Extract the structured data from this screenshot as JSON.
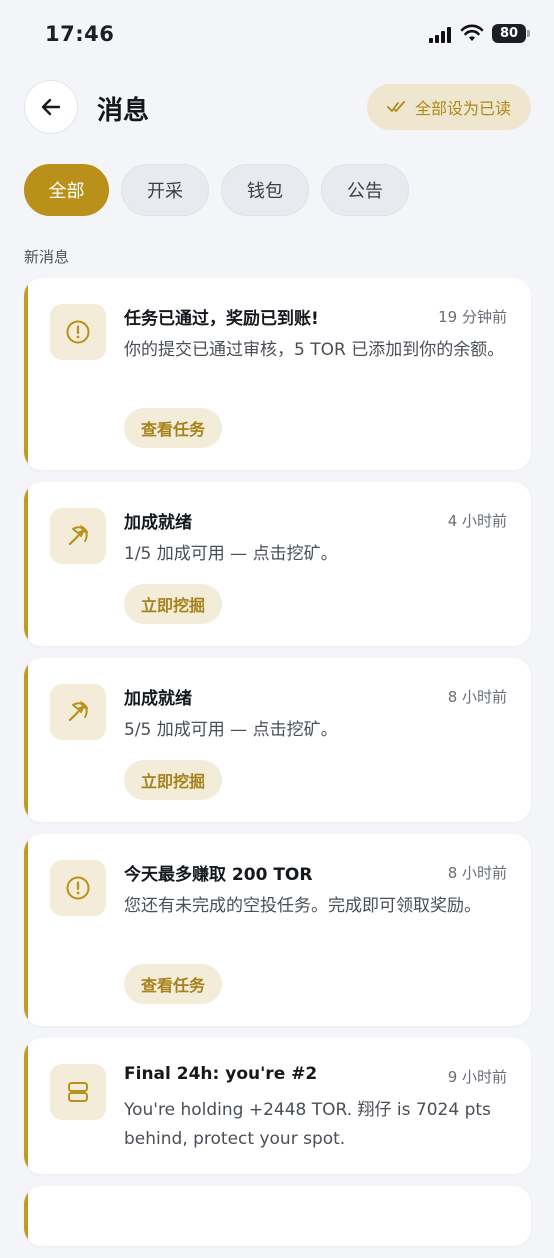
{
  "status_bar": {
    "time": "17:46",
    "battery": "80"
  },
  "header": {
    "title": "消息",
    "mark_all_read": "全部设为已读"
  },
  "tabs": [
    {
      "label": "全部",
      "active": true
    },
    {
      "label": "开采",
      "active": false
    },
    {
      "label": "钱包",
      "active": false
    },
    {
      "label": "公告",
      "active": false
    }
  ],
  "section_label": "新消息",
  "notifications": [
    {
      "icon": "alert-circle-icon",
      "title": "任务已通过，奖励已到账!",
      "time": "19 分钟前",
      "body": "你的提交已通过审核，5 TOR 已添加到你的余额。",
      "action": "查看任务"
    },
    {
      "icon": "pickaxe-icon",
      "title": "加成就绪",
      "time": "4 小时前",
      "body": "1/5 加成可用 — 点击挖矿。",
      "action": "立即挖掘"
    },
    {
      "icon": "pickaxe-icon",
      "title": "加成就绪",
      "time": "8 小时前",
      "body": "5/5 加成可用 — 点击挖矿。",
      "action": "立即挖掘"
    },
    {
      "icon": "alert-circle-icon",
      "title": "今天最多赚取 200 TOR",
      "time": "8 小时前",
      "body": "您还有未完成的空投任务。完成即可领取奖励。",
      "action": "查看任务"
    },
    {
      "icon": "server-icon",
      "title": "Final 24h: you're #2",
      "time": "9 小时前",
      "body": "You're holding +2448 TOR. 翔仔 is 7024 pts behind, protect your spot.",
      "action": ""
    }
  ],
  "colors": {
    "accent": "#b8901a",
    "accent_soft": "#f3ecd9",
    "background": "#f3f5f8"
  }
}
